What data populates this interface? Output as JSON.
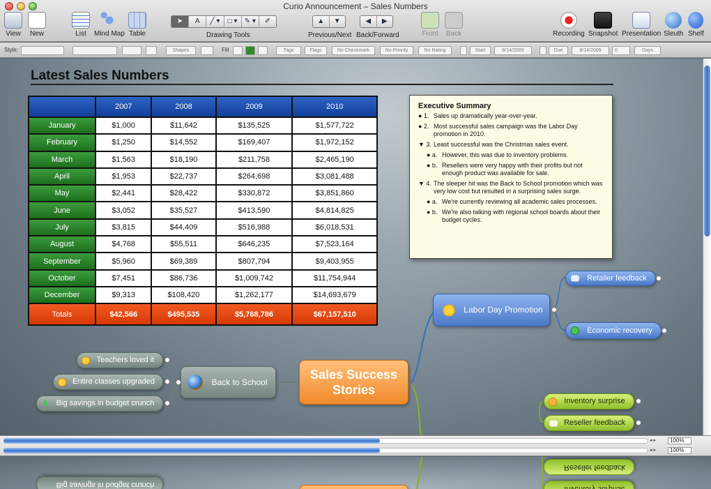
{
  "window": {
    "title": "Curio Announcement – Sales Numbers"
  },
  "toolbar": {
    "view": "View",
    "new": "New",
    "list": "List",
    "mind_map": "Mind Map",
    "table": "Table",
    "drawing_tools": "Drawing Tools",
    "previous_next": "Previous/Next",
    "back_forward": "Back/Forward",
    "front": "Front",
    "back": "Back",
    "recording": "Recording",
    "snapshot": "Snapshot",
    "presentation": "Presentation",
    "sleuth": "Sleuth",
    "shelf": "Shelf",
    "text_tool_glyph": "A"
  },
  "stylebar": {
    "style_label": "Style:",
    "shapes": "Shapes",
    "fill_label": "Fill",
    "tags": "Tags",
    "flags": "Flags",
    "no_checkmark": "No Checkmark",
    "no_priority": "No Priority",
    "no_rating": "No Rating",
    "start": "Start",
    "start_date": "8/14/2009",
    "due": "Due",
    "due_date": "8/14/2009",
    "duration": "0",
    "days": "Days"
  },
  "canvas": {
    "heading": "Latest Sales Numbers",
    "table": {
      "columns": [
        "2007",
        "2008",
        "2009",
        "2010"
      ],
      "rows": [
        {
          "month": "January",
          "values": [
            "$1,000",
            "$11,642",
            "$135,525",
            "$1,577,722"
          ]
        },
        {
          "month": "February",
          "values": [
            "$1,250",
            "$14,552",
            "$169,407",
            "$1,972,152"
          ]
        },
        {
          "month": "March",
          "values": [
            "$1,563",
            "$18,190",
            "$211,758",
            "$2,465,190"
          ]
        },
        {
          "month": "April",
          "values": [
            "$1,953",
            "$22,737",
            "$264,698",
            "$3,081,488"
          ]
        },
        {
          "month": "May",
          "values": [
            "$2,441",
            "$28,422",
            "$330,872",
            "$3,851,860"
          ]
        },
        {
          "month": "June",
          "values": [
            "$3,052",
            "$35,527",
            "$413,590",
            "$4,814,825"
          ]
        },
        {
          "month": "July",
          "values": [
            "$3,815",
            "$44,409",
            "$516,988",
            "$6,018,531"
          ]
        },
        {
          "month": "August",
          "values": [
            "$4,768",
            "$55,511",
            "$646,235",
            "$7,523,164"
          ]
        },
        {
          "month": "September",
          "values": [
            "$5,960",
            "$69,389",
            "$807,794",
            "$9,403,955"
          ]
        },
        {
          "month": "October",
          "values": [
            "$7,451",
            "$86,736",
            "$1,009,742",
            "$11,754,944"
          ]
        },
        {
          "month": "December",
          "values": [
            "$9,313",
            "$108,420",
            "$1,262,177",
            "$14,693,679"
          ]
        }
      ],
      "totals": {
        "label": "Totals",
        "values": [
          "$42,566",
          "$495,535",
          "$5,768,786",
          "$67,157,510"
        ]
      }
    },
    "exec_summary": {
      "title": "Executive Summary",
      "items": [
        {
          "bullet": "● 1.",
          "text": "Sales up dramatically year-over-year."
        },
        {
          "bullet": "● 2.",
          "text": "Most successful sales campaign was the Labor Day promotion in 2010."
        },
        {
          "bullet": "▼ 3.",
          "text": "Least successful was the Christmas sales event."
        },
        {
          "bullet": "● a.",
          "text": "However, this was due to inventory problems.",
          "sub": true
        },
        {
          "bullet": "● b.",
          "text": "Resellers were very happy with their profits but not enough product was available for sale.",
          "sub": true
        },
        {
          "bullet": "▼ 4.",
          "text": "The sleeper hit was the Back to School promotion which was very low cost but resulted in a surprising sales surge."
        },
        {
          "bullet": "● a.",
          "text": "We're currently reviewing all academic sales processes.",
          "sub": true
        },
        {
          "bullet": "● b.",
          "text": "We're also talking with regional school boards about their budget cycles.",
          "sub": true
        }
      ]
    },
    "mindmap": {
      "central": "Sales Success Stories",
      "labor_day": "Labor Day Promotion",
      "retailer_feedback": "Retailer feedback",
      "economic_recovery": "Economic recovery",
      "back_to_school": "Back to School",
      "teachers_loved": "Teachers loved it",
      "entire_classes": "Entire classes upgraded",
      "big_savings": "Big savings in budget crunch",
      "inventory_surprise": "Inventory surprise",
      "reseller_feedback": "Reseller feedback",
      "dollar_glyph": "$"
    }
  },
  "split": {
    "zoom_top": "100%",
    "zoom_bottom": "100%",
    "arrows": "◂ ▸"
  },
  "colors": {
    "header_blue": "#1f4fae",
    "month_green": "#2a862a",
    "totals_orange": "#e84a12",
    "central_orange": "#f18a2c"
  }
}
